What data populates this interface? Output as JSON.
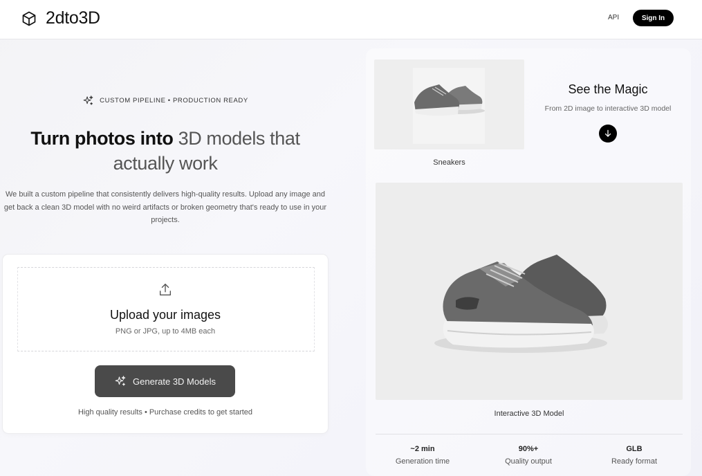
{
  "header": {
    "brand": "2dto3D",
    "nav_api": "API",
    "sign_in": "Sign In"
  },
  "hero": {
    "badge": "CUSTOM PIPELINE • PRODUCTION READY",
    "title_part1": "Turn photos into ",
    "title_part2": "3D models that",
    "title_part3": "actually work",
    "description": "We built a custom pipeline that consistently delivers high-quality results. Upload any image and get back a clean 3D model with no weird artifacts or broken geometry that's ready to use in your projects."
  },
  "upload": {
    "title": "Upload your images",
    "subtitle": "PNG or JPG, up to 4MB each",
    "generate_button": "Generate 3D Models",
    "footer": "High quality results • Purchase credits to get started"
  },
  "showcase": {
    "thumb_label": "Sneakers",
    "magic_title": "See the Magic",
    "magic_subtitle": "From 2D image to interactive 3D model",
    "model_label": "Interactive 3D Model"
  },
  "stats": [
    {
      "value": "~2 min",
      "label": "Generation time"
    },
    {
      "value": "90%+",
      "label": "Quality output"
    },
    {
      "value": "GLB",
      "label": "Ready format"
    }
  ],
  "icons": {
    "logo": "cube-icon",
    "badge": "sparkles-icon",
    "upload": "upload-icon",
    "generate": "sparkles-icon",
    "arrow": "arrow-down-icon"
  },
  "colors": {
    "primary": "#000000",
    "button_dark": "#4a4a4a",
    "muted_text": "#555555"
  }
}
